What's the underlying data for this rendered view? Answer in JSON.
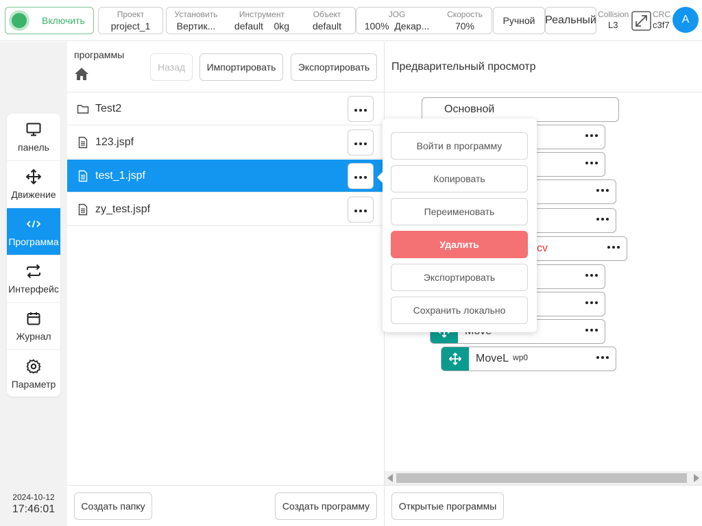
{
  "header": {
    "power_label": "Включить",
    "project": {
      "label": "Проект",
      "value": "project_1"
    },
    "install": {
      "label": "Установить",
      "value": "Вертик..."
    },
    "tool": {
      "label": "Инструмент",
      "value": "default",
      "weight": "0kg"
    },
    "object": {
      "label": "Объект",
      "value": "default"
    },
    "jog": {
      "label": "JOG",
      "value": "100%",
      "frame": "Декар..."
    },
    "speed": {
      "label": "Скорость",
      "value": "70%"
    },
    "mode": "Ручной",
    "run_mode": "Реальный",
    "collision": {
      "label": "Collision",
      "value": "L3"
    },
    "crc": {
      "label": "CRC",
      "value": "c3f7"
    },
    "avatar": "A"
  },
  "sidebar": {
    "items": [
      {
        "label": "панель",
        "icon": "monitor-icon"
      },
      {
        "label": "Движение",
        "icon": "move-arrows-icon"
      },
      {
        "label": "Программа",
        "icon": "code-icon",
        "active": true
      },
      {
        "label": "Интерфейс",
        "icon": "swap-arrows-icon"
      },
      {
        "label": "Журнал",
        "icon": "calendar-icon"
      },
      {
        "label": "Параметр",
        "icon": "gear-icon"
      }
    ]
  },
  "datetime": {
    "date": "2024-10-12",
    "time": "17:46:01"
  },
  "programs": {
    "title": "программы",
    "back_label": "Назад",
    "import_label": "Импортировать",
    "export_label": "Экспортировать",
    "files": [
      {
        "name": "Test2",
        "type": "folder"
      },
      {
        "name": "123.jspf",
        "type": "file"
      },
      {
        "name": "test_1.jspf",
        "type": "file",
        "selected": true
      },
      {
        "name": "zy_test.jspf",
        "type": "file"
      }
    ],
    "create_folder_label": "Создать папку",
    "create_program_label": "Создать программу"
  },
  "preview": {
    "title": "Предварительный просмотр",
    "root_label": "Основной",
    "red_fragment": "cv",
    "move_label": "Move",
    "movel_label": "MoveL",
    "movel_sub": "wp0",
    "open_programs_label": "Открытые программы"
  },
  "context_menu": {
    "items": [
      {
        "label": "Войти в программу"
      },
      {
        "label": "Копировать"
      },
      {
        "label": "Переименовать"
      },
      {
        "label": "Удалить",
        "danger": true
      },
      {
        "label": "Экспортировать"
      },
      {
        "label": "Сохранить локально"
      }
    ]
  },
  "colors": {
    "accent": "#1296f0",
    "danger": "#f47174",
    "teal": "#0b9a8f",
    "power": "#3bb36a",
    "warning_text": "#e53935"
  }
}
